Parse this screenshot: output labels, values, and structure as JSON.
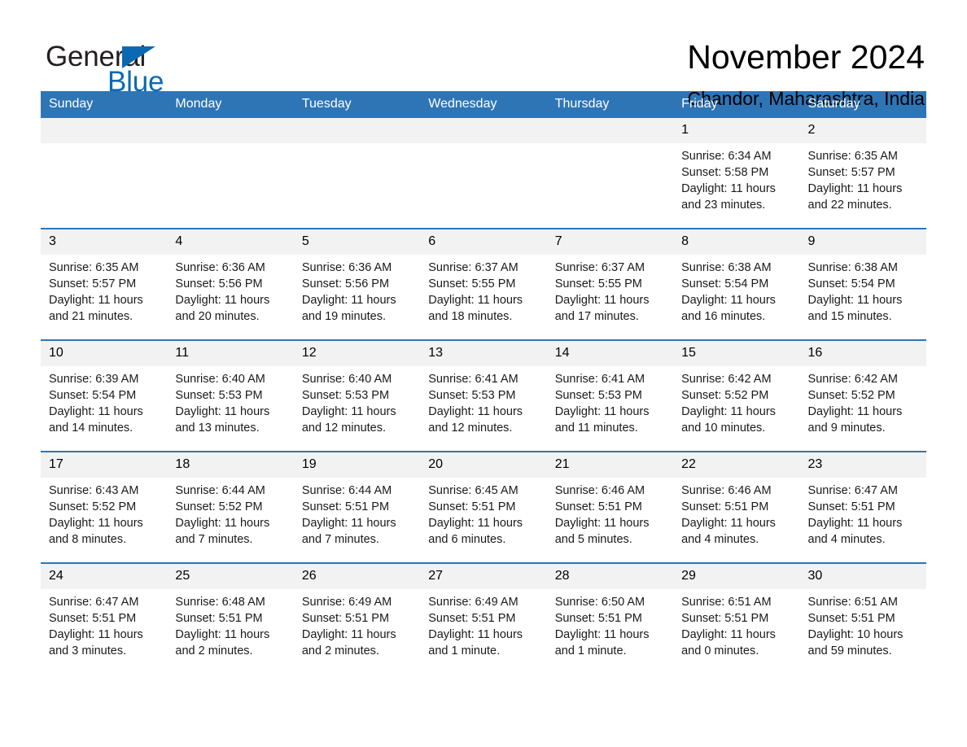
{
  "brand": {
    "name_part1": "General",
    "name_part2": "Blue",
    "logo_icon": "triangle-logo-icon",
    "accent_color": "#0b69b4"
  },
  "header": {
    "month_title": "November 2024",
    "location": "Chandor, Maharashtra, India"
  },
  "theme": {
    "header_blue": "#2e75b6",
    "daynum_band": "#f2f2f2",
    "separator_blue": "#2e75b6"
  },
  "calendar": {
    "weekday_headers": [
      "Sunday",
      "Monday",
      "Tuesday",
      "Wednesday",
      "Thursday",
      "Friday",
      "Saturday"
    ],
    "labels": {
      "sunrise_prefix": "Sunrise:",
      "sunset_prefix": "Sunset:",
      "daylight_prefix": "Daylight:"
    },
    "weeks": [
      [
        {
          "day": "",
          "empty": true
        },
        {
          "day": "",
          "empty": true
        },
        {
          "day": "",
          "empty": true
        },
        {
          "day": "",
          "empty": true
        },
        {
          "day": "",
          "empty": true
        },
        {
          "day": "1",
          "sunrise": "Sunrise: 6:34 AM",
          "sunset": "Sunset: 5:58 PM",
          "daylight": "Daylight: 11 hours and 23 minutes."
        },
        {
          "day": "2",
          "sunrise": "Sunrise: 6:35 AM",
          "sunset": "Sunset: 5:57 PM",
          "daylight": "Daylight: 11 hours and 22 minutes."
        }
      ],
      [
        {
          "day": "3",
          "sunrise": "Sunrise: 6:35 AM",
          "sunset": "Sunset: 5:57 PM",
          "daylight": "Daylight: 11 hours and 21 minutes."
        },
        {
          "day": "4",
          "sunrise": "Sunrise: 6:36 AM",
          "sunset": "Sunset: 5:56 PM",
          "daylight": "Daylight: 11 hours and 20 minutes."
        },
        {
          "day": "5",
          "sunrise": "Sunrise: 6:36 AM",
          "sunset": "Sunset: 5:56 PM",
          "daylight": "Daylight: 11 hours and 19 minutes."
        },
        {
          "day": "6",
          "sunrise": "Sunrise: 6:37 AM",
          "sunset": "Sunset: 5:55 PM",
          "daylight": "Daylight: 11 hours and 18 minutes."
        },
        {
          "day": "7",
          "sunrise": "Sunrise: 6:37 AM",
          "sunset": "Sunset: 5:55 PM",
          "daylight": "Daylight: 11 hours and 17 minutes."
        },
        {
          "day": "8",
          "sunrise": "Sunrise: 6:38 AM",
          "sunset": "Sunset: 5:54 PM",
          "daylight": "Daylight: 11 hours and 16 minutes."
        },
        {
          "day": "9",
          "sunrise": "Sunrise: 6:38 AM",
          "sunset": "Sunset: 5:54 PM",
          "daylight": "Daylight: 11 hours and 15 minutes."
        }
      ],
      [
        {
          "day": "10",
          "sunrise": "Sunrise: 6:39 AM",
          "sunset": "Sunset: 5:54 PM",
          "daylight": "Daylight: 11 hours and 14 minutes."
        },
        {
          "day": "11",
          "sunrise": "Sunrise: 6:40 AM",
          "sunset": "Sunset: 5:53 PM",
          "daylight": "Daylight: 11 hours and 13 minutes."
        },
        {
          "day": "12",
          "sunrise": "Sunrise: 6:40 AM",
          "sunset": "Sunset: 5:53 PM",
          "daylight": "Daylight: 11 hours and 12 minutes."
        },
        {
          "day": "13",
          "sunrise": "Sunrise: 6:41 AM",
          "sunset": "Sunset: 5:53 PM",
          "daylight": "Daylight: 11 hours and 12 minutes."
        },
        {
          "day": "14",
          "sunrise": "Sunrise: 6:41 AM",
          "sunset": "Sunset: 5:53 PM",
          "daylight": "Daylight: 11 hours and 11 minutes."
        },
        {
          "day": "15",
          "sunrise": "Sunrise: 6:42 AM",
          "sunset": "Sunset: 5:52 PM",
          "daylight": "Daylight: 11 hours and 10 minutes."
        },
        {
          "day": "16",
          "sunrise": "Sunrise: 6:42 AM",
          "sunset": "Sunset: 5:52 PM",
          "daylight": "Daylight: 11 hours and 9 minutes."
        }
      ],
      [
        {
          "day": "17",
          "sunrise": "Sunrise: 6:43 AM",
          "sunset": "Sunset: 5:52 PM",
          "daylight": "Daylight: 11 hours and 8 minutes."
        },
        {
          "day": "18",
          "sunrise": "Sunrise: 6:44 AM",
          "sunset": "Sunset: 5:52 PM",
          "daylight": "Daylight: 11 hours and 7 minutes."
        },
        {
          "day": "19",
          "sunrise": "Sunrise: 6:44 AM",
          "sunset": "Sunset: 5:51 PM",
          "daylight": "Daylight: 11 hours and 7 minutes."
        },
        {
          "day": "20",
          "sunrise": "Sunrise: 6:45 AM",
          "sunset": "Sunset: 5:51 PM",
          "daylight": "Daylight: 11 hours and 6 minutes."
        },
        {
          "day": "21",
          "sunrise": "Sunrise: 6:46 AM",
          "sunset": "Sunset: 5:51 PM",
          "daylight": "Daylight: 11 hours and 5 minutes."
        },
        {
          "day": "22",
          "sunrise": "Sunrise: 6:46 AM",
          "sunset": "Sunset: 5:51 PM",
          "daylight": "Daylight: 11 hours and 4 minutes."
        },
        {
          "day": "23",
          "sunrise": "Sunrise: 6:47 AM",
          "sunset": "Sunset: 5:51 PM",
          "daylight": "Daylight: 11 hours and 4 minutes."
        }
      ],
      [
        {
          "day": "24",
          "sunrise": "Sunrise: 6:47 AM",
          "sunset": "Sunset: 5:51 PM",
          "daylight": "Daylight: 11 hours and 3 minutes."
        },
        {
          "day": "25",
          "sunrise": "Sunrise: 6:48 AM",
          "sunset": "Sunset: 5:51 PM",
          "daylight": "Daylight: 11 hours and 2 minutes."
        },
        {
          "day": "26",
          "sunrise": "Sunrise: 6:49 AM",
          "sunset": "Sunset: 5:51 PM",
          "daylight": "Daylight: 11 hours and 2 minutes."
        },
        {
          "day": "27",
          "sunrise": "Sunrise: 6:49 AM",
          "sunset": "Sunset: 5:51 PM",
          "daylight": "Daylight: 11 hours and 1 minute."
        },
        {
          "day": "28",
          "sunrise": "Sunrise: 6:50 AM",
          "sunset": "Sunset: 5:51 PM",
          "daylight": "Daylight: 11 hours and 1 minute."
        },
        {
          "day": "29",
          "sunrise": "Sunrise: 6:51 AM",
          "sunset": "Sunset: 5:51 PM",
          "daylight": "Daylight: 11 hours and 0 minutes."
        },
        {
          "day": "30",
          "sunrise": "Sunrise: 6:51 AM",
          "sunset": "Sunset: 5:51 PM",
          "daylight": "Daylight: 10 hours and 59 minutes."
        }
      ]
    ]
  }
}
